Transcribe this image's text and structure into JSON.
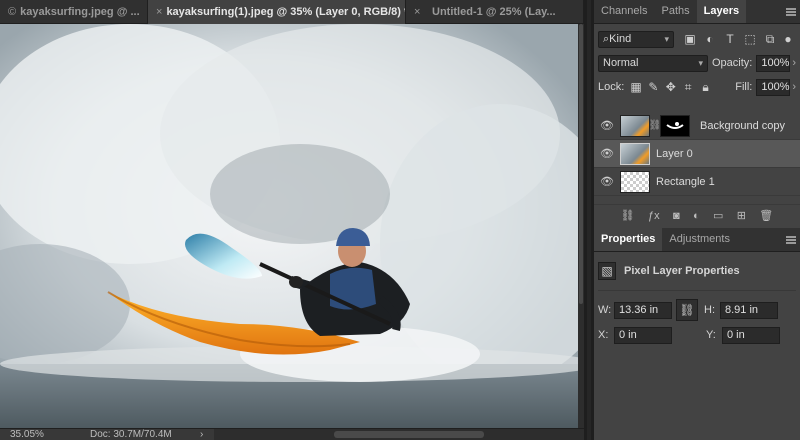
{
  "doc_tabs": [
    {
      "close": "",
      "label": "kayaksurfing.jpeg @ ...",
      "active": false,
      "copyright": "©"
    },
    {
      "close": "×",
      "label": "kayaksurfing(1).jpeg @ 35% (Layer 0, RGB/8) *",
      "active": true
    },
    {
      "close": "×",
      "label": "Untitled-1 @ 25% (Lay...",
      "active": false
    }
  ],
  "status": {
    "zoom": "35.05%",
    "doc": "Doc: 30.7M/70.4M",
    "arrow": "›"
  },
  "layers_panel": {
    "tabs": [
      "Channels",
      "Paths",
      "Layers"
    ],
    "filter_kind": "Kind",
    "blend_mode": "Normal",
    "opacity_label": "Opacity:",
    "opacity_value": "100%",
    "lock_label": "Lock:",
    "fill_label": "Fill:",
    "fill_value": "100%",
    "layers": [
      {
        "name": "Background copy",
        "selected": false,
        "has_mask": true
      },
      {
        "name": "Layer 0",
        "selected": true,
        "has_mask": false
      },
      {
        "name": "Rectangle 1",
        "selected": false,
        "has_mask": false
      }
    ],
    "tool_icons": [
      "link-icon",
      "fx-icon",
      "mask-icon",
      "adjustment-icon",
      "folder-icon",
      "new-layer-icon",
      "trash-icon"
    ]
  },
  "properties_panel": {
    "tabs": [
      "Properties",
      "Adjustments"
    ],
    "title": "Pixel Layer Properties",
    "w_label": "W:",
    "w_value": "13.36 in",
    "h_label": "H:",
    "h_value": "8.91 in",
    "x_label": "X:",
    "x_value": "0 in",
    "y_label": "Y:",
    "y_value": "0 in"
  },
  "colors": {
    "kayak": "#f5a020",
    "water": "#6b7a82",
    "spray": "#e8ecee",
    "paddle_blade": "#7fd0e6"
  }
}
